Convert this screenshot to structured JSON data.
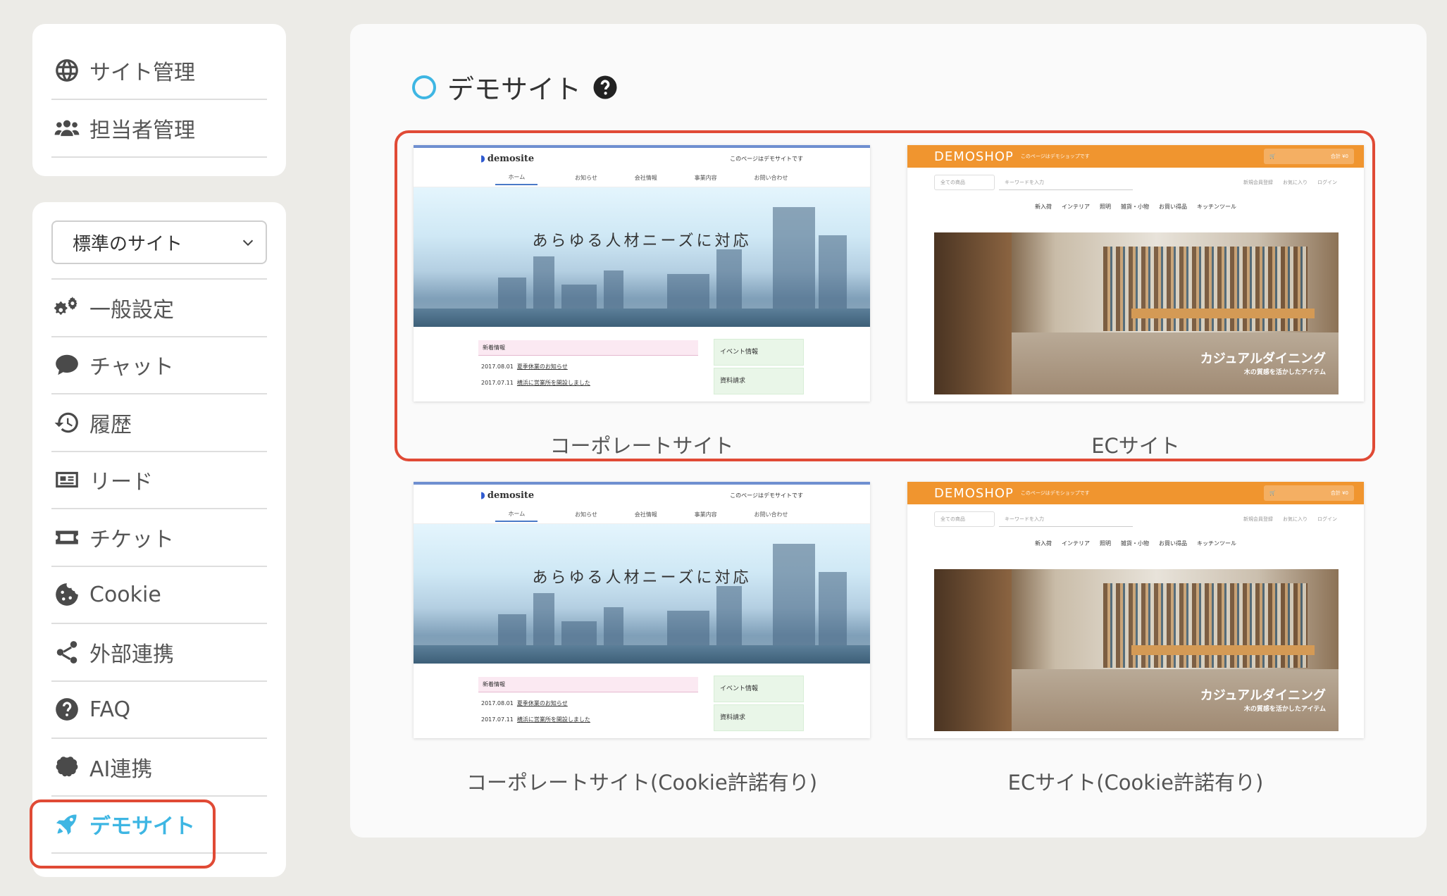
{
  "sidebar_top": {
    "items": [
      {
        "label": "サイト管理"
      },
      {
        "label": "担当者管理"
      }
    ]
  },
  "sidebar": {
    "site_select": {
      "value": "標準のサイト"
    },
    "items": [
      {
        "label": "一般設定"
      },
      {
        "label": "チャット"
      },
      {
        "label": "履歴"
      },
      {
        "label": "リード"
      },
      {
        "label": "チケット"
      },
      {
        "label": "Cookie"
      },
      {
        "label": "外部連携"
      },
      {
        "label": "FAQ"
      },
      {
        "label": "AI連携"
      },
      {
        "label": "デモサイト"
      }
    ],
    "active_color": "#3eb6e3"
  },
  "main": {
    "heading": "デモサイト",
    "cards": [
      {
        "caption": "コーポレートサイト"
      },
      {
        "caption": "ECサイト"
      },
      {
        "caption": "コーポレートサイト(Cookie許諾有り)"
      },
      {
        "caption": "ECサイト(Cookie許諾有り)"
      }
    ]
  },
  "thumb_corp": {
    "logo": "demosite",
    "note": "このページはデモサイトです",
    "nav": [
      "ホーム",
      "お知らせ",
      "会社情報",
      "事業内容",
      "お問い合わせ"
    ],
    "hero": "あらゆる人材ニーズに対応",
    "news_title": "新着情報",
    "news": [
      {
        "date": "2017.08.01",
        "text": "夏季休業のお知らせ"
      },
      {
        "date": "2017.07.11",
        "text": "横浜に営業所を開設しました"
      }
    ],
    "side": [
      "イベント情報",
      "資料請求"
    ]
  },
  "thumb_ec": {
    "logo": "DEMOSHOP",
    "note": "このページはデモショップです",
    "cart": "合計 ¥0",
    "select": "全ての商品",
    "search_placeholder": "キーワードを入力",
    "links": [
      "新規会員登録",
      "お気に入り",
      "ログイン"
    ],
    "cats": [
      "新入荷",
      "インテリア",
      "照明",
      "雑貨・小物",
      "お買い得品",
      "キッチンツール"
    ],
    "hero_title": "カジュアルダイニング",
    "hero_sub": "木の質感を活かしたアイテム"
  },
  "colors": {
    "highlight": "#e04a35",
    "accent": "#3eb6e3",
    "ec_orange": "#f0952f"
  }
}
